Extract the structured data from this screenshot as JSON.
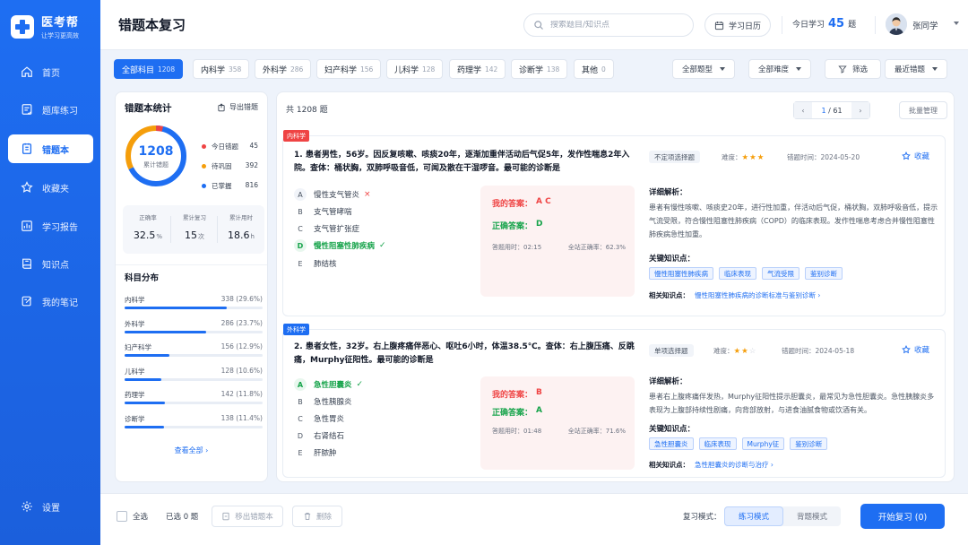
{
  "app": {
    "name": "医考帮",
    "slogan": "让学习更高效"
  },
  "nav": {
    "items": [
      {
        "label": "首页",
        "icon": "home-icon"
      },
      {
        "label": "题库练习",
        "icon": "question-bank-icon"
      },
      {
        "label": "错题本",
        "icon": "notebook-icon",
        "active": true
      },
      {
        "label": "收藏夹",
        "icon": "star-icon"
      },
      {
        "label": "学习报告",
        "icon": "report-icon"
      },
      {
        "label": "知识点",
        "icon": "book-icon"
      },
      {
        "label": "我的笔记",
        "icon": "note-icon"
      }
    ],
    "settings": "设置"
  },
  "header": {
    "title": "错题本复习",
    "search_placeholder": "搜索题目/知识点",
    "calendar": "学习日历",
    "today_label": "今日学习",
    "today_count": "45",
    "today_unit": "题",
    "user": "张同学"
  },
  "filters": {
    "subjects": [
      {
        "label": "全部科目",
        "count": "1208",
        "active": true
      },
      {
        "label": "内科学",
        "count": "358"
      },
      {
        "label": "外科学",
        "count": "286"
      },
      {
        "label": "妇产科学",
        "count": "156"
      },
      {
        "label": "儿科学",
        "count": "128"
      },
      {
        "label": "药理学",
        "count": "142"
      },
      {
        "label": "诊断学",
        "count": "138"
      },
      {
        "label": "其他",
        "count": "0"
      }
    ],
    "type": "全部题型",
    "difficulty": "全部难度",
    "filter": "筛选",
    "sort": "最近错题"
  },
  "stats": {
    "title": "错题本统计",
    "export": "导出错题",
    "total": "1208",
    "total_label": "累计错题",
    "donut_fractions": [
      0.037,
      0.325,
      0.676
    ],
    "legend": [
      {
        "label": "今日错题",
        "value": "45",
        "color": "#ef4444"
      },
      {
        "label": "待巩固",
        "value": "392",
        "color": "#f59e0b"
      },
      {
        "label": "已掌握",
        "value": "816",
        "color": "#1e6ef2"
      }
    ],
    "metrics": [
      {
        "label": "正确率",
        "value": "32.5",
        "unit": "%"
      },
      {
        "label": "累计复习",
        "value": "15",
        "unit": "次"
      },
      {
        "label": "累计用时",
        "value": "18.6",
        "unit": "h"
      }
    ],
    "dist_title": "科目分布",
    "distribution": [
      {
        "name": "内科学",
        "value": "338 (29.6%)",
        "pct": 29.6
      },
      {
        "name": "外科学",
        "value": "286 (23.7%)",
        "pct": 23.7
      },
      {
        "name": "妇产科学",
        "value": "156 (12.9%)",
        "pct": 12.9
      },
      {
        "name": "儿科学",
        "value": "128 (10.6%)",
        "pct": 10.6
      },
      {
        "name": "药理学",
        "value": "142 (11.8%)",
        "pct": 11.8
      },
      {
        "name": "诊断学",
        "value": "138 (11.4%)",
        "pct": 11.4
      }
    ],
    "view_all": "查看全部 ›"
  },
  "list": {
    "count_text": "共 1208 题",
    "page_current": "1",
    "page_total": "/ 61",
    "batch": "批量管理",
    "questions": [
      {
        "tag": "内科学",
        "tag_color": "#ef4444",
        "stem": "1. 患者男性，56岁。因反复咳嗽、咳痰20年，逐渐加重伴活动后气促5年，发作性喘息2年入院。查体：桶状胸，双肺呼吸音低，可闻及散在干湿啰音。最可能的诊断是",
        "options": [
          {
            "letter": "A",
            "text": "慢性支气管炎",
            "state": "wrong",
            "mark": "×"
          },
          {
            "letter": "B",
            "text": "支气管哮喘",
            "state": "",
            "mark": ""
          },
          {
            "letter": "C",
            "text": "支气管扩张症",
            "state": "",
            "mark": ""
          },
          {
            "letter": "D",
            "text": "慢性阻塞性肺疾病",
            "state": "correct",
            "mark": "✓"
          },
          {
            "letter": "E",
            "text": "肺结核",
            "state": "",
            "mark": ""
          }
        ],
        "my_answer_label": "我的答案：",
        "my_answer": "A C",
        "correct_label": "正确答案：",
        "correct_answer": "D",
        "time_text": "答题用时：02:15",
        "rate_text": "全站正确率：62.3%",
        "type": "不定项选择题",
        "difficulty_label": "难度：",
        "stars": 3,
        "date_text": "错题时间：2024-05-20",
        "fav": "收藏",
        "detail_label": "详细解析：",
        "detail": "患者有慢性咳嗽、咳痰史20年，进行性加重，伴活动后气促，桶状胸，双肺呼吸音低，提示气流受限，符合慢性阻塞性肺疾病（COPD）的临床表现。发作性喘息考虑合并慢性阻塞性肺疾病急性加重。",
        "kp_label": "关键知识点：",
        "knowledge": [
          "慢性阻塞性肺疾病",
          "临床表现",
          "气流受限",
          "鉴别诊断"
        ],
        "related_label": "相关知识点：",
        "related": "慢性阻塞性肺疾病的诊断标准与鉴别诊断 ›"
      },
      {
        "tag": "外科学",
        "tag_color": "#1e6ef2",
        "stem": "2. 患者女性，32岁。右上腹疼痛伴恶心、呕吐6小时，体温38.5℃。查体：右上腹压痛、反跳痛，Murphy征阳性。最可能的诊断是",
        "options": [
          {
            "letter": "A",
            "text": "急性胆囊炎",
            "state": "correct",
            "mark": "✓"
          },
          {
            "letter": "B",
            "text": "急性胰腺炎",
            "state": "",
            "mark": ""
          },
          {
            "letter": "C",
            "text": "急性胃炎",
            "state": "",
            "mark": ""
          },
          {
            "letter": "D",
            "text": "右肾结石",
            "state": "",
            "mark": ""
          },
          {
            "letter": "E",
            "text": "肝脓肿",
            "state": "",
            "mark": ""
          }
        ],
        "my_answer_label": "我的答案：",
        "my_answer": "B",
        "correct_label": "正确答案：",
        "correct_answer": "A",
        "time_text": "答题用时：01:48",
        "rate_text": "全站正确率：71.6%",
        "type": "单项选择题",
        "difficulty_label": "难度：",
        "stars": 2,
        "date_text": "错题时间：2024-05-18",
        "fav": "收藏",
        "detail_label": "详细解析：",
        "detail": "患者右上腹疼痛伴发热，Murphy征阳性提示胆囊炎，最常见为急性胆囊炎。急性胰腺炎多表现为上腹部持续性剧痛，向背部放射，与进食油腻食物或饮酒有关。",
        "kp_label": "关键知识点：",
        "knowledge": [
          "急性胆囊炎",
          "临床表现",
          "Murphy征",
          "鉴别诊断"
        ],
        "related_label": "相关知识点：",
        "related": "急性胆囊炎的诊断与治疗 ›"
      }
    ]
  },
  "bottom": {
    "select_all": "全选",
    "selected": "已选 0 题",
    "move_out": "移出错题本",
    "delete": "删除",
    "mode_label": "复习模式：",
    "mode_practice": "练习模式",
    "mode_memorize": "背题模式",
    "start": "开始复习 (0)"
  },
  "colors": {
    "primary": "#1e6ef2",
    "danger": "#ef4444",
    "success": "#16a34a",
    "warning": "#f59e0b"
  }
}
